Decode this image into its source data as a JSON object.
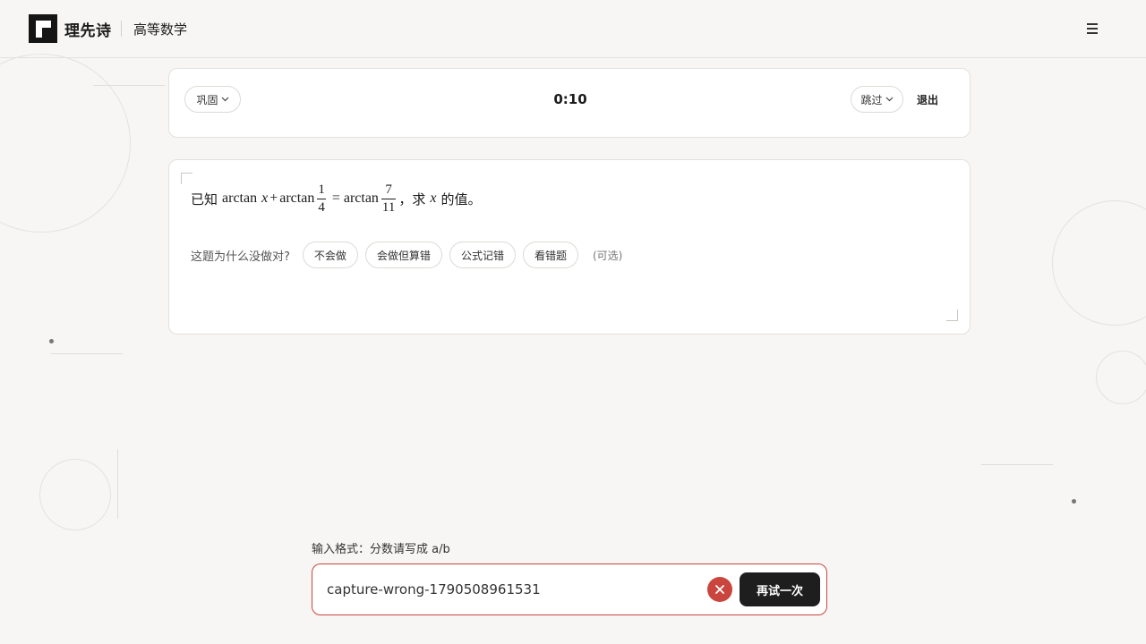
{
  "header": {
    "brand": "理先诗",
    "course": "高等数学",
    "menu_icon": "hamburger-icon"
  },
  "controls": {
    "mode_label": "巩固",
    "timer": "0:10",
    "skip_label": "跳过",
    "quit_label": "退出",
    "chevron_icon": "chevron-down-icon"
  },
  "question": {
    "prefix": "已知",
    "fn1": "arctan",
    "var1": "x",
    "plus": "+",
    "fn2": "arctan",
    "frac1_num": "1",
    "frac1_den": "4",
    "equals": "=",
    "fn3": "arctan",
    "frac2_num": "7",
    "frac2_den": "11",
    "mid": "，求",
    "var2": "x",
    "suffix": "的值。"
  },
  "reasons": {
    "label": "这题为什么没做对?",
    "options": [
      "不会做",
      "会做但算错",
      "公式记错",
      "看错题"
    ],
    "optional_note": "(可选)"
  },
  "answer": {
    "format_hint": "输入格式：分数请写成 a/b",
    "value": "capture-wrong-1790508961531",
    "clear_icon": "close-icon",
    "retry_label": "再试一次"
  },
  "colors": {
    "accent_red": "#c9453d",
    "dark": "#1e1e1e",
    "background": "#f7f6f4"
  }
}
